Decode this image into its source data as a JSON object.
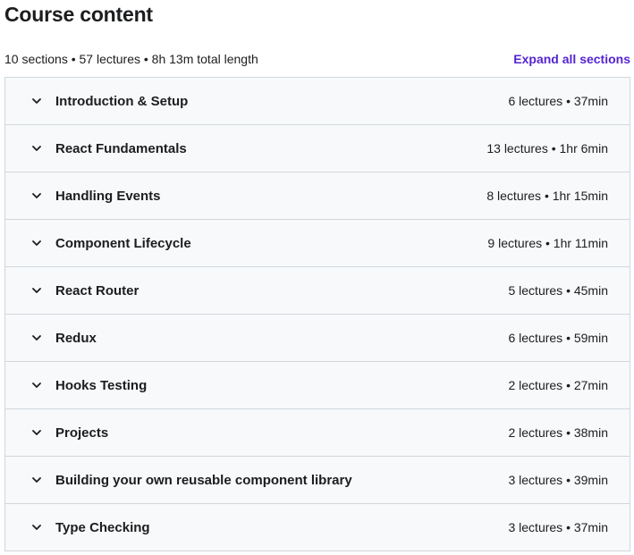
{
  "header": {
    "title": "Course content",
    "summary": "10 sections • 57 lectures • 8h 13m total length",
    "expand_all_label": "Expand all sections"
  },
  "sections": [
    {
      "title": "Introduction & Setup",
      "meta": "6 lectures • 37min"
    },
    {
      "title": "React Fundamentals",
      "meta": "13 lectures • 1hr 6min"
    },
    {
      "title": "Handling Events",
      "meta": "8 lectures • 1hr 15min"
    },
    {
      "title": "Component Lifecycle",
      "meta": "9 lectures • 1hr 11min"
    },
    {
      "title": "React Router",
      "meta": "5 lectures • 45min"
    },
    {
      "title": "Redux",
      "meta": "6 lectures • 59min"
    },
    {
      "title": "Hooks Testing",
      "meta": "2 lectures • 27min"
    },
    {
      "title": "Projects",
      "meta": "2 lectures • 38min"
    },
    {
      "title": "Building your own reusable component library",
      "meta": "3 lectures • 39min"
    },
    {
      "title": "Type Checking",
      "meta": "3 lectures • 37min"
    }
  ],
  "icons": {
    "section_toggle": "chevron-down-icon"
  },
  "colors": {
    "accent": "#5624d0",
    "text": "#1c1d1f",
    "row_background": "#f7f9fa",
    "border": "#d1d7dc"
  }
}
